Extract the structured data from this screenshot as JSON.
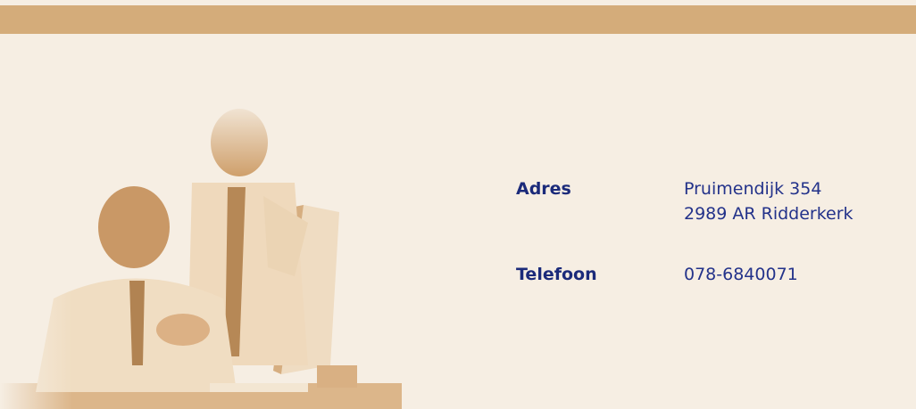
{
  "colors": {
    "background": "#f6eee3",
    "top_bar": "#d4ac7a",
    "label": "#1b2a7a",
    "value": "#23328a",
    "photo_tint": "#d9b083"
  },
  "photo": {
    "icon": "office-workers-photo"
  },
  "contact": {
    "address_label": "Adres",
    "address_line1": "Pruimendijk 354",
    "address_line2": "2989 AR Ridderkerk",
    "phone_label": "Telefoon",
    "phone_value": "078-6840071"
  }
}
